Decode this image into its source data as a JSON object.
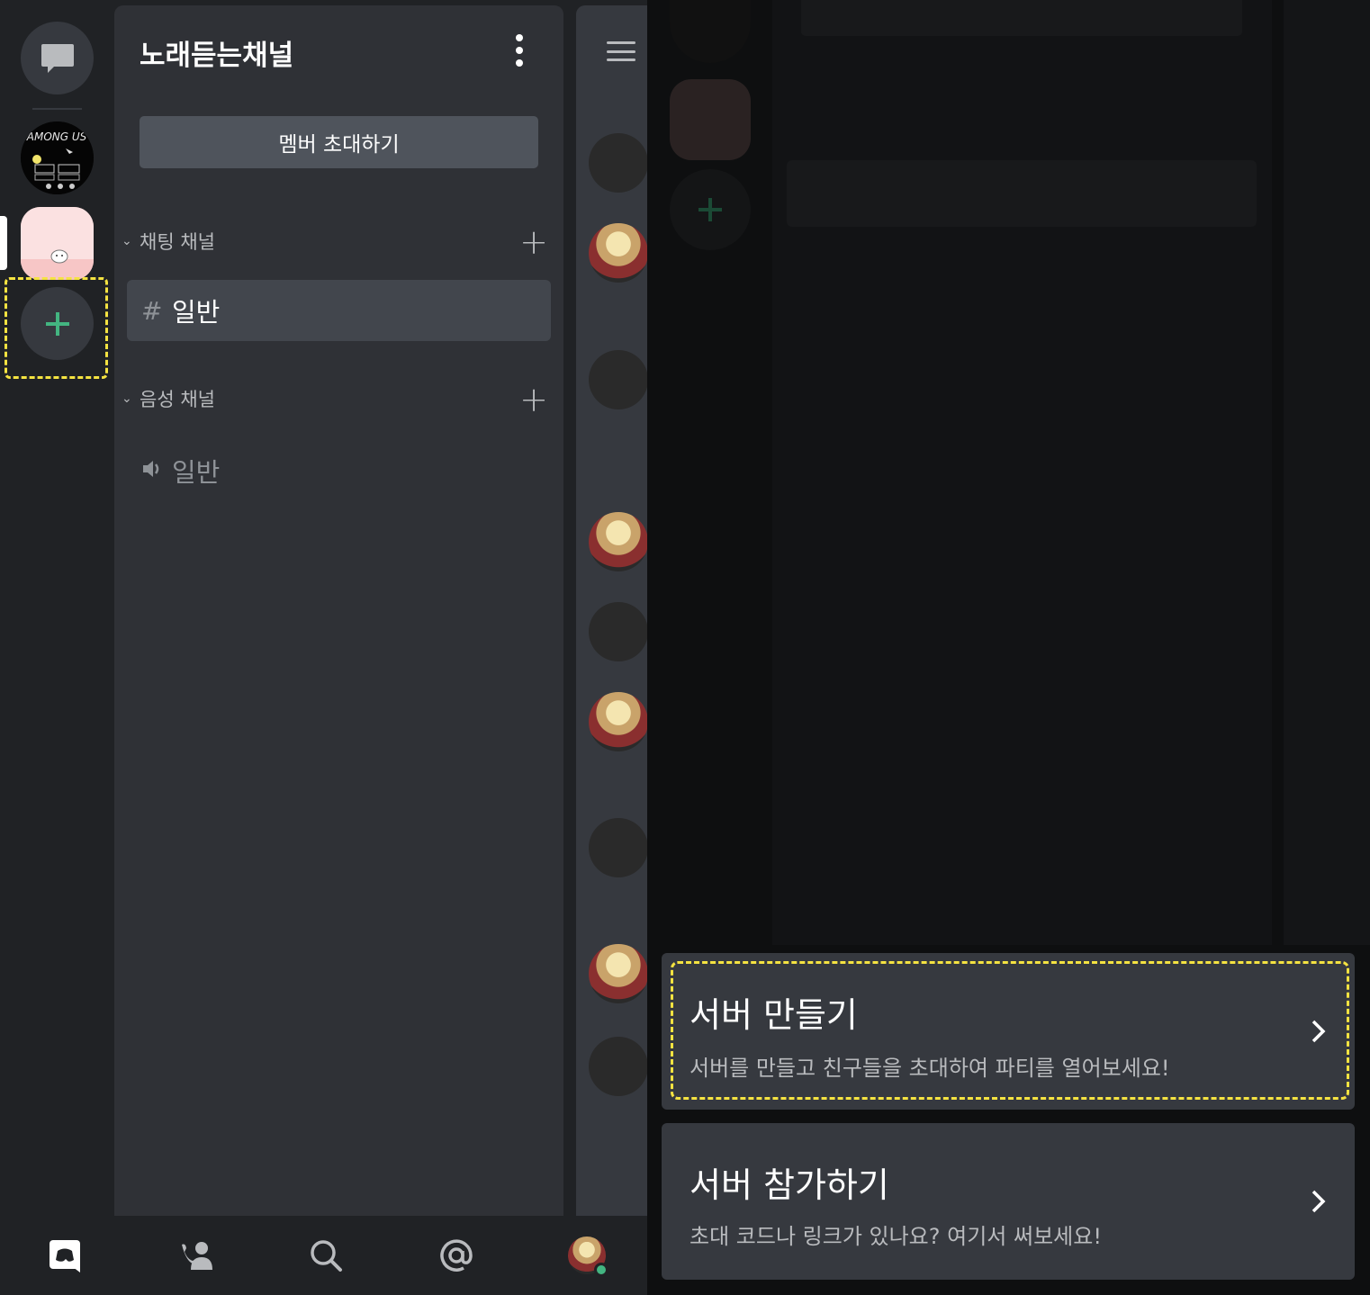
{
  "server": {
    "name": "노래듣는채널",
    "invite_label": "멤버 초대하기"
  },
  "categories": {
    "text": {
      "label": "채팅 채널",
      "channel": "일반"
    },
    "voice": {
      "label": "음성 채널",
      "channel": "일반"
    }
  },
  "guilds": {
    "among_logo_text": "AMONG US"
  },
  "sheet": {
    "create": {
      "title": "서버 만들기",
      "desc": "서버를 만들고 친구들을 초대하여 파티를 열어보세요!"
    },
    "join": {
      "title": "서버 참가하기",
      "desc": "초대 코드나 링크가 있나요? 여기서 써보세요!"
    }
  },
  "colors": {
    "accent_green": "#43b581",
    "highlight_yellow": "#f5e341",
    "status_online": "#43b581"
  },
  "icons": {
    "nav": [
      "discord-home-icon",
      "friends-icon",
      "search-icon",
      "mentions-icon",
      "profile-avatar"
    ]
  }
}
